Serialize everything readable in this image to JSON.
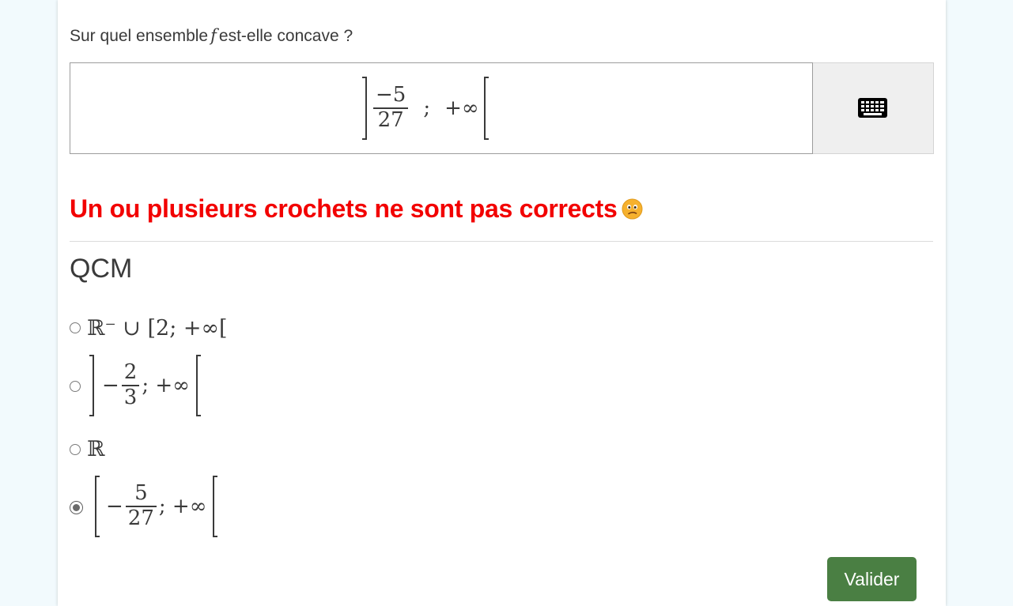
{
  "question": {
    "prefix": "Sur quel ensemble",
    "var": "f",
    "suffix": "est-elle concave ?"
  },
  "answer_input": {
    "left_bracket": "]",
    "numerator": "−5",
    "denominator": "27",
    "separator": ";",
    "upper": "+∞",
    "right_bracket": "["
  },
  "keyboard_button": {
    "icon": "keyboard-icon"
  },
  "feedback": {
    "text": "Un ou plusieurs crochets ne sont pas corrects",
    "icon": "confused-face-icon",
    "color": "#f20000"
  },
  "qcm": {
    "title": "QCM",
    "options": [
      {
        "text": "ℝ⁻ ∪ [2; +∞[",
        "selected": false
      },
      {
        "prefix": "−",
        "numerator": "2",
        "denominator": "3",
        "suffix": "; +∞",
        "selected": false
      },
      {
        "text": "ℝ",
        "selected": false
      },
      {
        "prefix": "−",
        "numerator": "5",
        "denominator": "27",
        "suffix": "; +∞",
        "selected": true
      }
    ]
  },
  "submit": {
    "label": "Valider",
    "color": "#4a7f43"
  }
}
